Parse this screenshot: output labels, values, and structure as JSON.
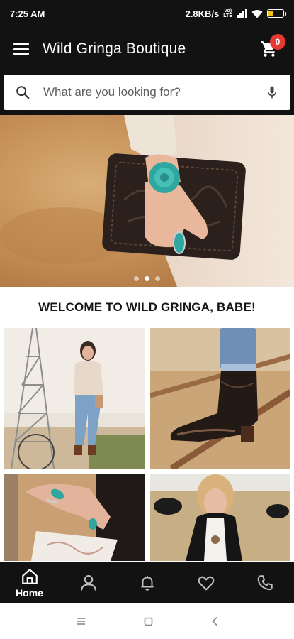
{
  "status_bar": {
    "time": "7:25 AM",
    "net_speed": "2.8KB/s",
    "network_badge_top": "Vo)",
    "network_badge_bottom": "LTE",
    "battery_level": 0.35,
    "battery_color": "#f3c11b"
  },
  "app_bar": {
    "menu_icon": "hamburger-menu-icon",
    "title": "Wild Gringa Boutique",
    "cart_icon": "shopping-cart-icon",
    "cart_count": "0"
  },
  "search": {
    "placeholder": "What are you looking for?",
    "value": "",
    "left_icon": "search-icon",
    "right_icon": "microphone-icon"
  },
  "hero_carousel": {
    "image": "woman holding tooled leather clutch wearing turquoise rings",
    "slide_count": 3,
    "active_slide": 2
  },
  "welcome": {
    "heading": "WELCOME TO WILD GRINGA, BABE!"
  },
  "collection_grid": [
    {
      "image": "woman in western outfit standing by windmill"
    },
    {
      "image": "black western boot on wooden fence"
    },
    {
      "image": "hands with turquoise rings and white tooled bag"
    },
    {
      "image": "blonde woman in front of pasture with cattle"
    }
  ],
  "bottom_nav": {
    "items": [
      {
        "icon": "home-icon",
        "label": "Home",
        "active": true
      },
      {
        "icon": "user-icon",
        "label": "",
        "active": false
      },
      {
        "icon": "bell-icon",
        "label": "",
        "active": false
      },
      {
        "icon": "heart-icon",
        "label": "",
        "active": false
      },
      {
        "icon": "phone-icon",
        "label": "",
        "active": false
      }
    ]
  },
  "system_nav": {
    "items": [
      "recent-apps-icon",
      "home-square-icon",
      "back-icon"
    ]
  },
  "colors": {
    "bar_background": "#121212",
    "badge": "#e53935",
    "accent_turquoise": "#2fa7a0"
  }
}
